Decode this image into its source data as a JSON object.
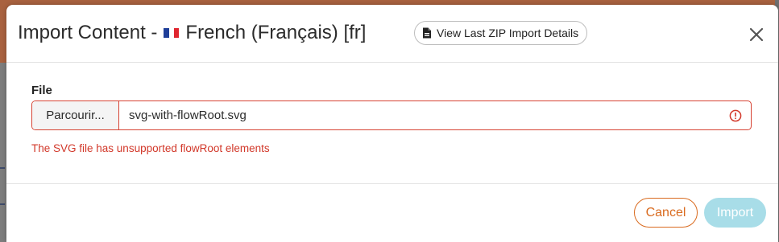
{
  "modal": {
    "title_prefix": "Import Content -",
    "language": "French (Français) [fr]",
    "zip_button_label": "View Last ZIP Import Details",
    "close_icon": "close-icon",
    "file_label": "File",
    "browse_label": "Parcourir...",
    "filename": "svg-with-flowRoot.svg",
    "error_message": "The SVG file has unsupported flowRoot elements",
    "cancel_label": "Cancel",
    "import_label": "Import",
    "import_disabled": true
  },
  "colors": {
    "error": "#d2382a",
    "cancel": "#d96a1e",
    "import_disabled_bg": "#a8dde8",
    "flag_blue": "#1f3f99",
    "flag_white": "#ffffff",
    "flag_red": "#e0262f"
  }
}
